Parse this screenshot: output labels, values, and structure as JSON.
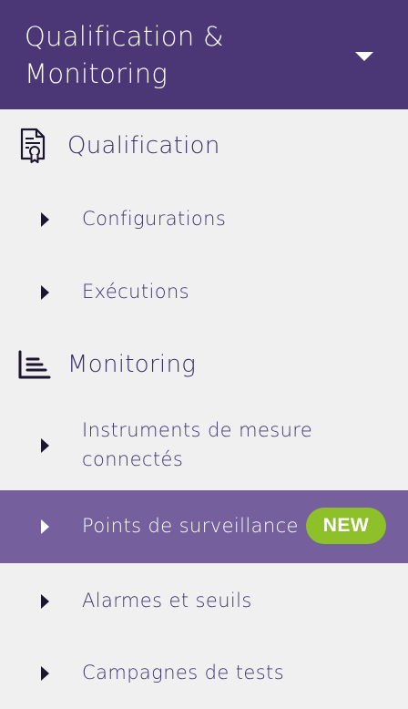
{
  "header": {
    "title": "Qualification & Monitoring",
    "dropdown_icon": "chevron-down-icon"
  },
  "sections": {
    "qualification": {
      "label": "Qualification",
      "icon": "certificate-document-icon",
      "items": [
        {
          "label": "Configurations"
        },
        {
          "label": "Exécutions"
        }
      ]
    },
    "monitoring": {
      "label": "Monitoring",
      "icon": "bar-chart-icon",
      "items": [
        {
          "label": "Instruments de mesure connectés"
        },
        {
          "label": "Points de surveillance",
          "badge": "NEW",
          "active": true
        },
        {
          "label": "Alarmes et seuils"
        },
        {
          "label": "Campagnes de tests"
        }
      ]
    }
  },
  "colors": {
    "header_bg": "#4b3776",
    "page_bg": "#f0f0f0",
    "active_bg": "#755f9d",
    "badge_bg": "#8ec02a",
    "text": "#3a2d6b"
  }
}
